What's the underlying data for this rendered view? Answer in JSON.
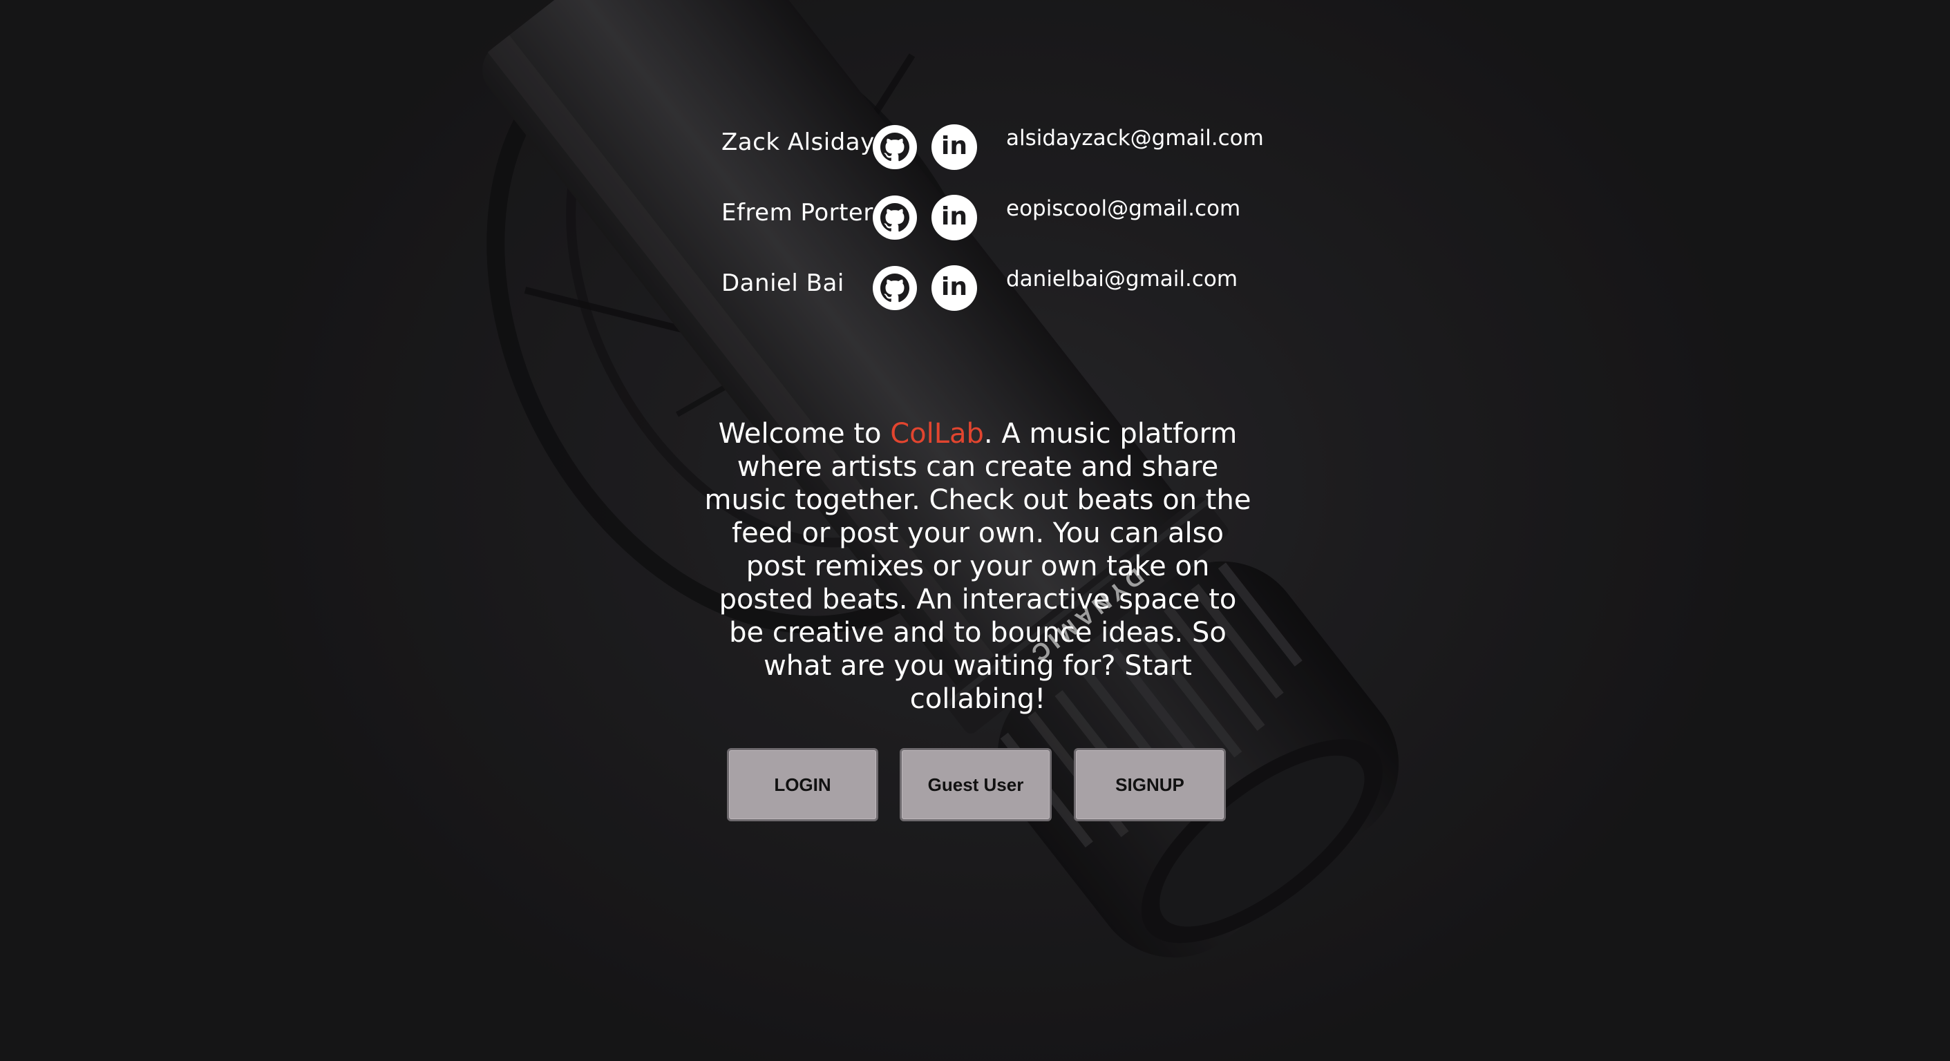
{
  "team": {
    "members": [
      {
        "name": "Zack Alsiday",
        "github_icon": "github-icon",
        "linkedin_icon": "linkedin-icon",
        "linkedin_label": "in",
        "email": "alsidayzack@gmail.com"
      },
      {
        "name": "Efrem Porter",
        "github_icon": "github-icon",
        "linkedin_icon": "linkedin-icon",
        "linkedin_label": "in",
        "email": "eopiscool@gmail.com"
      },
      {
        "name": "Daniel Bai",
        "github_icon": "github-icon",
        "linkedin_icon": "linkedin-icon",
        "linkedin_label": "in",
        "email": "danielbai@gmail.com"
      }
    ]
  },
  "intro": {
    "before_brand": "Welcome to ",
    "brand": "ColLab",
    "after_brand": ". A music platform where artists can create and share music together. Check out beats on the feed or post your own. You can also post remixes or your own take on posted beats. An interactive space to be creative and to bounce ideas. So what are you waiting for? Start collabing!"
  },
  "actions": {
    "login_label": "LOGIN",
    "guest_label": "Guest User",
    "signup_label": "SIGNUP"
  },
  "background": {
    "subject": "dynamic microphone on shock mount",
    "mic_label": "DYNAMIC"
  },
  "colors": {
    "background": "#1a191b",
    "text": "#ffffff",
    "brand_accent": "#e2452f",
    "button_fill": "#a8a2a6",
    "button_border": "#6e6a6e"
  }
}
